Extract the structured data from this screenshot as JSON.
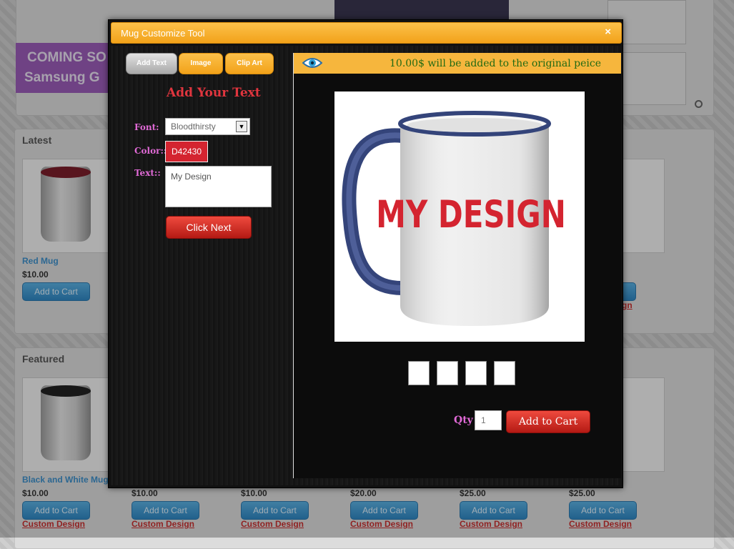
{
  "background_page": {
    "banner": {
      "line1": "COMING SO",
      "line2": "Samsung G"
    },
    "sections": {
      "latest": "Latest",
      "featured": "Featured"
    },
    "latest_products": [
      {
        "name": "Red Mug",
        "price": "$10.00",
        "cart_label": "Add to Cart"
      }
    ],
    "featured_products": [
      {
        "name": "Black and White Mug",
        "price": "$10.00",
        "cart_label": "Add to Cart",
        "custom_label": "Custom Design"
      },
      {
        "price": "$10.00",
        "cart_label": "Add to Cart",
        "custom_label": "Custom Design"
      },
      {
        "price": "$10.00",
        "cart_label": "Add to Cart",
        "custom_label": "Custom Design"
      },
      {
        "price": "$20.00",
        "cart_label": "Add to Cart",
        "custom_label": "Custom Design"
      },
      {
        "price": "$25.00",
        "cart_label": "Add to Cart",
        "custom_label": "Custom Design"
      },
      {
        "price": "$25.00",
        "cart_label": "Add to Cart",
        "custom_label": "Custom Design"
      }
    ],
    "partial_link": "gn"
  },
  "modal": {
    "title": "Mug Customize Tool",
    "close_icon": "×",
    "tabs": [
      {
        "label": "Add Text",
        "active": true
      },
      {
        "label": "Image",
        "active": false
      },
      {
        "label": "Clip Art",
        "active": false
      }
    ],
    "heading": "Add Your Text",
    "font_label": "Font:",
    "font_value": "Bloodthirsty",
    "color_label": "Color::",
    "color_value": "D42430",
    "text_label": "Text::",
    "text_value": "My Design",
    "next_label": "Click Next",
    "price_note": "10.00$ will be added to the original peice",
    "design_text": "MY DESIGN",
    "qty_label": "Qty",
    "qty_value": "1",
    "add_to_cart_label": "Add to Cart"
  },
  "colors": {
    "accent_orange": "#f6b63d",
    "design_red": "#d42430",
    "label_pink": "#e06ad6",
    "price_green": "#226a13"
  }
}
